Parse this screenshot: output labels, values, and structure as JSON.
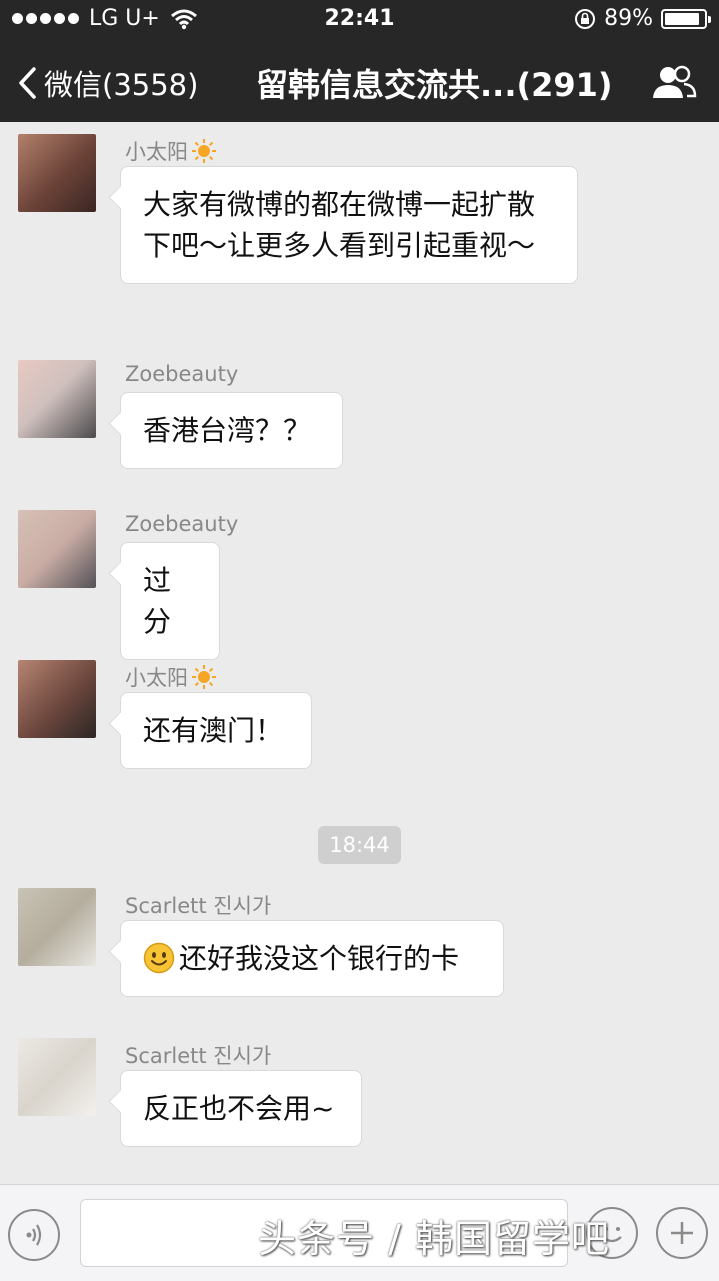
{
  "status_bar": {
    "carrier": "LG U+",
    "time": "22:41",
    "battery": "89%",
    "battery_level": 0.89
  },
  "nav": {
    "back_label": "微信(3558)",
    "title": "留韩信息交流共...(291)"
  },
  "messages": [
    {
      "sender": "小太阳",
      "sender_emoji": "sun-icon",
      "text": "大家有微博的都在微博一起扩散下吧～让更多人看到引起重视～"
    },
    {
      "sender": "Zoebeauty",
      "text": "香港台湾？？"
    },
    {
      "sender": "Zoebeauty",
      "text": "过分"
    },
    {
      "sender": "小太阳",
      "sender_emoji": "sun-icon",
      "text": "还有澳门！"
    },
    {
      "sender": "Scarlett 진시가",
      "text": "还好我没这个银行的卡",
      "leading_emoji": "smiley-icon"
    },
    {
      "sender": "Scarlett 진시가",
      "text": "反正也不会用~"
    }
  ],
  "timestamp": "18:44",
  "watermark": "头条号 / 韩国留学吧",
  "colors": {
    "bar": "#272727",
    "chat_bg": "#ebebeb",
    "bubble": "#ffffff",
    "timestamp_bg": "#cfcfcf"
  }
}
